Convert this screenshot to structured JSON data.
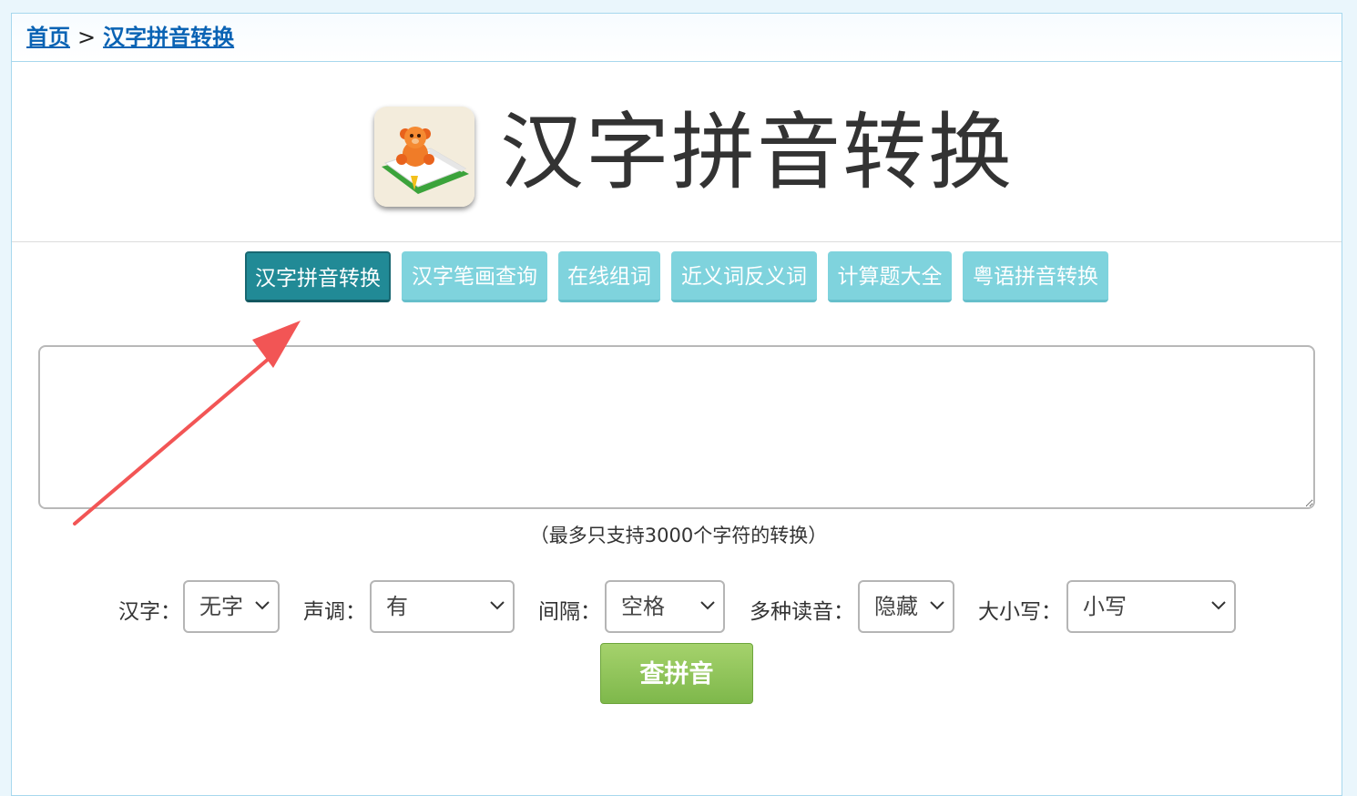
{
  "breadcrumb": {
    "home": "首页",
    "separator": ">",
    "current": "汉字拼音转换"
  },
  "hero": {
    "title": "汉字拼音转换",
    "logo_icon": "teddy-bear-book-icon"
  },
  "tabs": [
    {
      "label": "汉字拼音转换",
      "active": true
    },
    {
      "label": "汉字笔画查询",
      "active": false
    },
    {
      "label": "在线组词",
      "active": false
    },
    {
      "label": "近义词反义词",
      "active": false
    },
    {
      "label": "计算题大全",
      "active": false
    },
    {
      "label": "粤语拼音转换",
      "active": false
    }
  ],
  "input": {
    "value": "",
    "hint": "（最多只支持3000个字符的转换）"
  },
  "options": {
    "hanzi": {
      "label": "汉字：",
      "value": "无字"
    },
    "tone": {
      "label": "声调：",
      "value": "有"
    },
    "spacing": {
      "label": "间隔：",
      "value": "空格"
    },
    "polyphone": {
      "label": "多种读音：",
      "value": "隐藏"
    },
    "case": {
      "label": "大小写：",
      "value": "小写"
    }
  },
  "submit_label": "查拼音",
  "colors": {
    "active_tab": "#218a96",
    "tab": "#7fd3dd",
    "link": "#0a63b4",
    "submit": "#8cc152",
    "annotation_arrow": "#f25555",
    "border": "#a7d8ee"
  }
}
